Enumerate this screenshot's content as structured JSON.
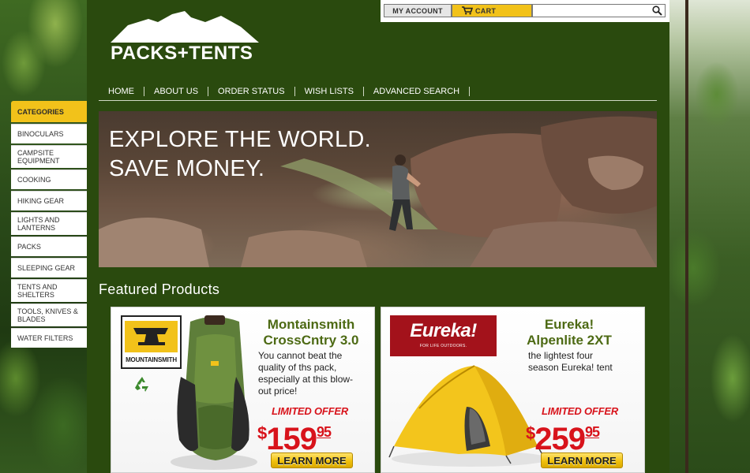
{
  "brand": {
    "logo_text": "PACKS+TENTS"
  },
  "topbar": {
    "account_label": "MY ACCOUNT",
    "cart_label": "CART",
    "search_placeholder": ""
  },
  "nav": {
    "items": [
      "HOME",
      "ABOUT US",
      "ORDER STATUS",
      "WISH LISTS",
      "ADVANCED SEARCH"
    ]
  },
  "sidebar": {
    "header": "CATEGORIES",
    "items": [
      {
        "label": "BINOCULARS"
      },
      {
        "label": "CAMPSITE EQUIPMENT"
      },
      {
        "label": "COOKING"
      },
      {
        "label": "HIKING GEAR"
      },
      {
        "label": "LIGHTS AND LANTERNS"
      },
      {
        "label": "PACKS"
      },
      {
        "label": "SLEEPING GEAR"
      },
      {
        "label": "TENTS AND SHELTERS"
      },
      {
        "label": "TOOLS, KNIVES & BLADES"
      },
      {
        "label": "WATER FILTERS"
      }
    ]
  },
  "hero": {
    "line1": "EXPLORE THE WORLD.",
    "line2": "SAVE MONEY."
  },
  "featured": {
    "title": "Featured Products",
    "products": [
      {
        "brand": "MOUNTAINSMITH",
        "title_line1": "Montainsmith",
        "title_line2": "CrossCntry 3.0",
        "desc": [
          "You cannot beat the",
          "quality of ths pack,",
          "especially at this blow-",
          "out price!"
        ],
        "offer": "LIMITED OFFER",
        "price_currency": "$",
        "price_whole": "159",
        "price_cents": "95",
        "cta": "LEARN MORE"
      },
      {
        "brand": "Eureka!",
        "brand_tagline": "FOR LIFE OUTDOORS.",
        "title_line1": "Eureka!",
        "title_line2": "Alpenlite 2XT",
        "desc": [
          "the lightest four",
          "season Eureka! tent"
        ],
        "offer": "LIMITED OFFER",
        "price_currency": "$",
        "price_whole": "259",
        "price_cents": "95",
        "cta": "LEARN MORE"
      }
    ]
  },
  "colors": {
    "accent_yellow": "#f2c21a",
    "main_green": "#2a4a0e",
    "title_green": "#4d6a14",
    "offer_red": "#d8131b",
    "eureka_red": "#a3121b"
  }
}
